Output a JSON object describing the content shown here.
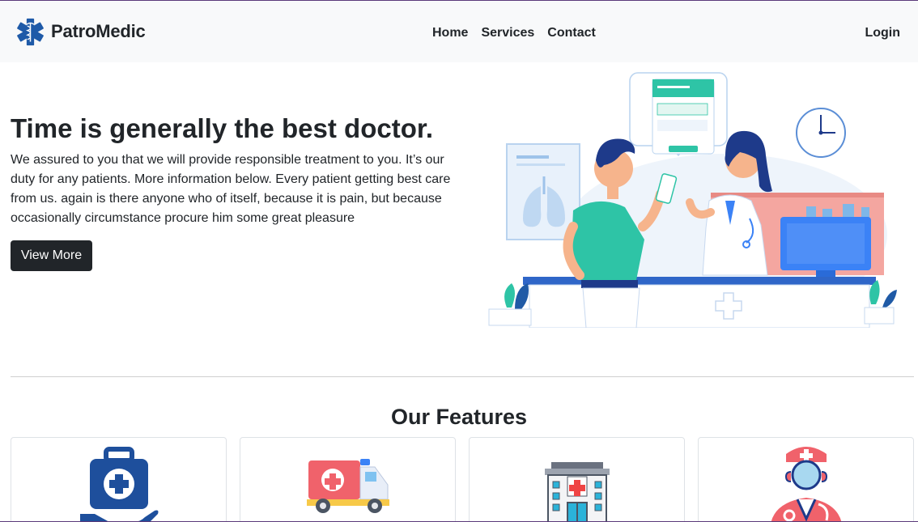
{
  "brand": {
    "name": "PatroMedic",
    "logo_icon": "star-of-life-icon"
  },
  "nav": {
    "links": [
      "Home",
      "Services",
      "Contact"
    ],
    "login": "Login"
  },
  "hero": {
    "title": "Time is generally the best doctor.",
    "text": "We assured to you that we will provide responsible treatment to you. It’s our duty for any patients. More information below. Every patient getting best care from us. again is there anyone who of itself, because it is pain, but because occasionally circumstance procure him some great pleasure",
    "button": "View More",
    "illustration": "doctor-patient-consultation-illustration"
  },
  "features": {
    "title": "Our Features",
    "cards": [
      {
        "icon": "medical-kit-hand-icon"
      },
      {
        "icon": "ambulance-icon"
      },
      {
        "icon": "hospital-building-icon"
      },
      {
        "icon": "doctor-icon"
      }
    ]
  },
  "colors": {
    "dark": "#212529",
    "navbar_bg": "#f8f9fa",
    "teal": "#2ec4a6",
    "blue": "#3b82f6",
    "red": "#f0626b"
  }
}
